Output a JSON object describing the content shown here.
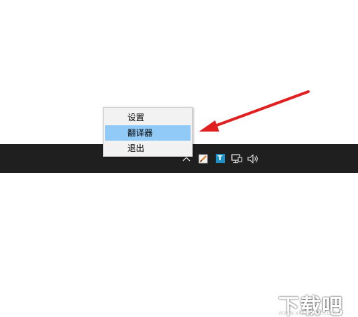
{
  "context_menu": {
    "items": [
      {
        "label": "设置",
        "highlighted": false
      },
      {
        "label": "翻译器",
        "highlighted": true
      },
      {
        "label": "退出",
        "highlighted": false
      }
    ]
  },
  "taskbar": {
    "tray_icons": [
      "chevron-up-icon",
      "pen-app-icon",
      "translator-t-icon",
      "network-icon",
      "volume-icon"
    ],
    "translator_icon_letter": "T"
  },
  "annotation": {
    "arrow_color": "#e02020"
  },
  "watermark": {
    "title": "下载吧",
    "url": "www.xiazaiba.com"
  },
  "colors": {
    "taskbar": "#1f1f1f",
    "menu_background": "#f2f2f2",
    "menu_highlight": "#91c9f7"
  }
}
